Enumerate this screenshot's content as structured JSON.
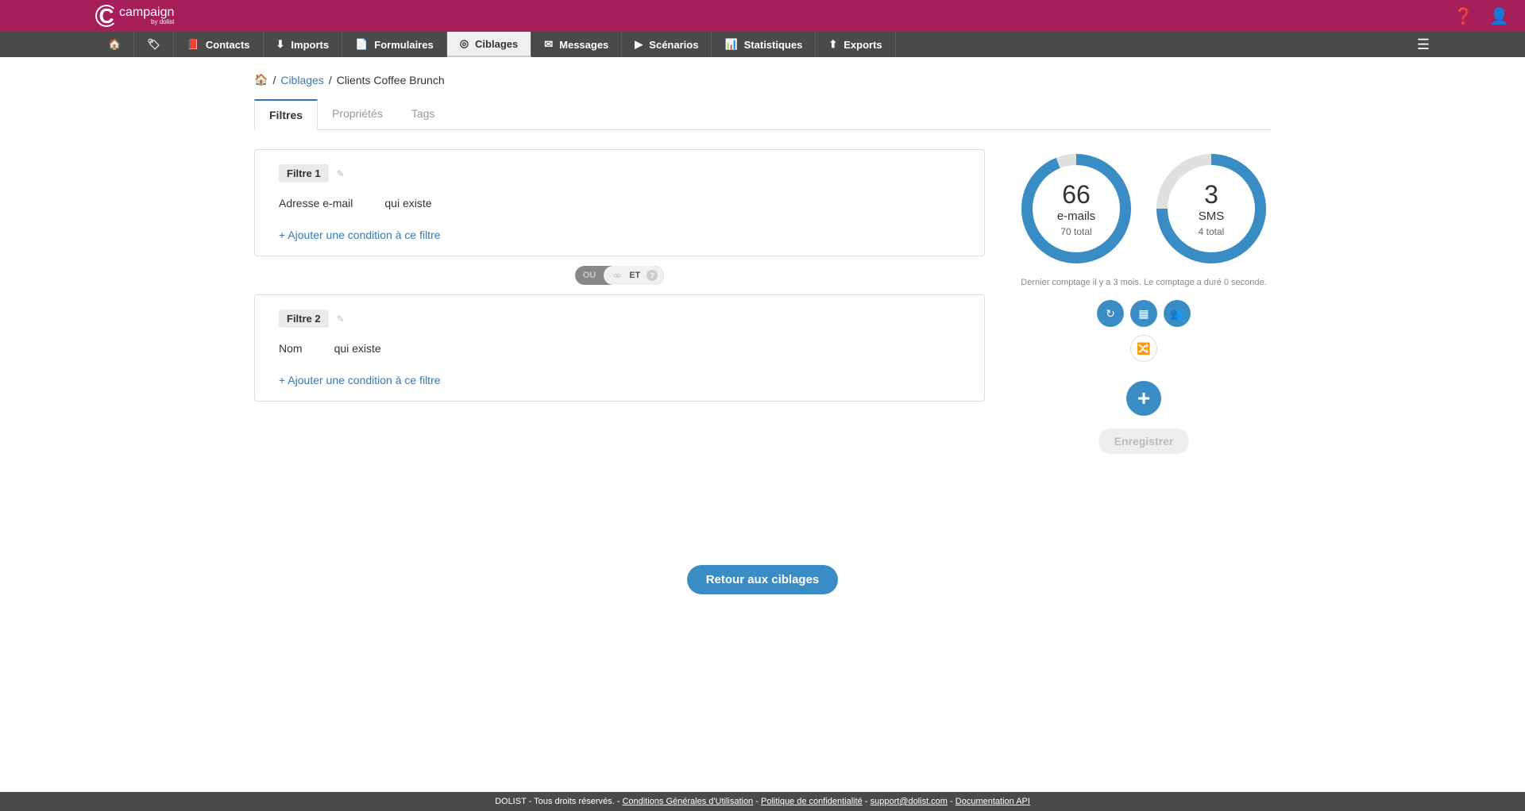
{
  "topbar": {
    "logo_main": "campaign",
    "logo_sub": "by dolist"
  },
  "nav": {
    "items": [
      {
        "icon": "🏠",
        "label": ""
      },
      {
        "icon": "🏷",
        "label": ""
      },
      {
        "icon": "📕",
        "label": "Contacts"
      },
      {
        "icon": "⬇",
        "label": "Imports"
      },
      {
        "icon": "📄",
        "label": "Formulaires"
      },
      {
        "icon": "◎",
        "label": "Ciblages",
        "active": true
      },
      {
        "icon": "✉",
        "label": "Messages"
      },
      {
        "icon": "▶",
        "label": "Scénarios"
      },
      {
        "icon": "📊",
        "label": "Statistiques"
      },
      {
        "icon": "⬆",
        "label": "Exports"
      }
    ]
  },
  "breadcrumb": {
    "link": "Ciblages",
    "current": "Clients Coffee Brunch"
  },
  "tabs": {
    "filtres": "Filtres",
    "proprietes": "Propriétés",
    "tags": "Tags"
  },
  "filters": [
    {
      "title": "Filtre 1",
      "field": "Adresse e-mail",
      "op": "qui existe",
      "add": "+ Ajouter une condition à ce filtre"
    },
    {
      "title": "Filtre 2",
      "field": "Nom",
      "op": "qui existe",
      "add": "+ Ajouter une condition à ce filtre"
    }
  ],
  "logic": {
    "ou": "OU",
    "et": "ET"
  },
  "stats": {
    "emails": {
      "count": "66",
      "label": "e-mails",
      "total": "70 total",
      "pct": 94
    },
    "sms": {
      "count": "3",
      "label": "SMS",
      "total": "4 total",
      "pct": 75
    },
    "info": "Dernier comptage il y a 3 mois. Le comptage a duré 0 seconde."
  },
  "buttons": {
    "save": "Enregistrer",
    "back": "Retour aux ciblages"
  },
  "footer": {
    "prefix": "DOLIST - Tous droits réservés. - ",
    "cgu": "Conditions Générales d'Utilisation",
    "privacy": "Politique de confidentialité",
    "support": "support@dolist.com",
    "doc": "Documentation API"
  }
}
